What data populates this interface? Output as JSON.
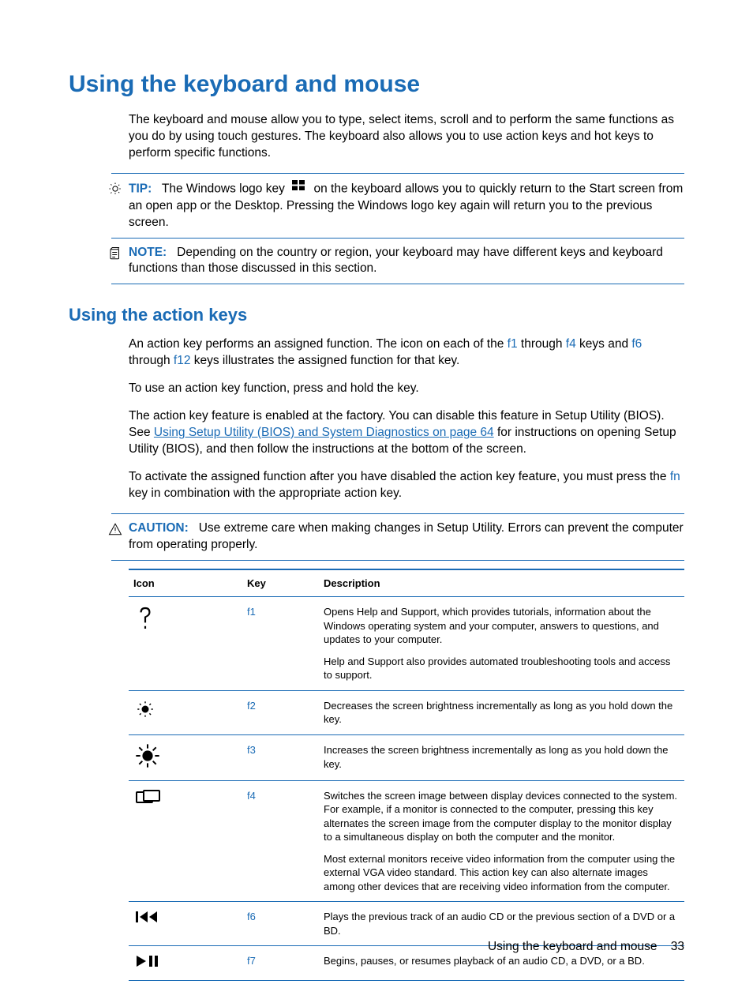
{
  "heading1": "Using the keyboard and mouse",
  "intro": "The keyboard and mouse allow you to type, select items, scroll and to perform the same functions as you do by using touch gestures. The keyboard also allows you to use action keys and hot keys to perform specific functions.",
  "tip": {
    "label": "TIP:",
    "text_before_icon": "The Windows logo key",
    "text_after_icon": "on the keyboard allows you to quickly return to the Start screen from an open app or the Desktop. Pressing the Windows logo key again will return you to the previous screen."
  },
  "note": {
    "label": "NOTE:",
    "text": "Depending on the country or region, your keyboard may have different keys and keyboard functions than those discussed in this section."
  },
  "heading2": "Using the action keys",
  "para_action1_pre": "An action key performs an assigned function. The icon on each of the ",
  "para_action1_f1": "f1",
  "para_action1_mid1": " through ",
  "para_action1_f4": "f4",
  "para_action1_mid2": " keys and ",
  "para_action1_f6": "f6",
  "para_action1_mid3": " through ",
  "para_action1_f12": "f12",
  "para_action1_post": " keys illustrates the assigned function for that key.",
  "para_action2": "To use an action key function, press and hold the key.",
  "para_action3_pre": "The action key feature is enabled at the factory. You can disable this feature in Setup Utility (BIOS). See ",
  "para_action3_link": "Using Setup Utility (BIOS) and System Diagnostics on page 64",
  "para_action3_post": " for instructions on opening Setup Utility (BIOS), and then follow the instructions at the bottom of the screen.",
  "para_action4_pre": "To activate the assigned function after you have disabled the action key feature, you must press the ",
  "para_action4_fn": "fn",
  "para_action4_post": " key in combination with the appropriate action key.",
  "caution": {
    "label": "CAUTION:",
    "text": "Use extreme care when making changes in Setup Utility. Errors can prevent the computer from operating properly."
  },
  "table": {
    "headers": {
      "icon": "Icon",
      "key": "Key",
      "desc": "Description"
    },
    "rows": [
      {
        "icon": "help-icon",
        "key": "f1",
        "desc": [
          "Opens Help and Support, which provides tutorials, information about the Windows operating system and your computer, answers to questions, and updates to your computer.",
          "Help and Support also provides automated troubleshooting tools and access to support."
        ]
      },
      {
        "icon": "brightness-down-icon",
        "key": "f2",
        "desc": [
          "Decreases the screen brightness incrementally as long as you hold down the key."
        ]
      },
      {
        "icon": "brightness-up-icon",
        "key": "f3",
        "desc": [
          "Increases the screen brightness incrementally as long as you hold down the key."
        ]
      },
      {
        "icon": "switch-display-icon",
        "key": "f4",
        "desc": [
          "Switches the screen image between display devices connected to the system. For example, if a monitor is connected to the computer, pressing this key alternates the screen image from the computer display to the monitor display to a simultaneous display on both the computer and the monitor.",
          "Most external monitors receive video information from the computer using the external VGA video standard. This action key can also alternate images among other devices that are receiving video information from the computer."
        ]
      },
      {
        "icon": "previous-track-icon",
        "key": "f6",
        "desc": [
          "Plays the previous track of an audio CD or the previous section of a DVD or a BD."
        ]
      },
      {
        "icon": "play-pause-icon",
        "key": "f7",
        "desc": [
          "Begins, pauses, or resumes playback of an audio CD, a DVD, or a BD."
        ]
      }
    ]
  },
  "footer": {
    "title": "Using the keyboard and mouse",
    "page": "33"
  }
}
